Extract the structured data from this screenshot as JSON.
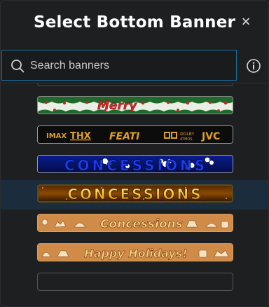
{
  "dialog": {
    "title": "Select Bottom Banner",
    "close_glyph": "×",
    "close_icon": "close-icon"
  },
  "search": {
    "placeholder": "Search banners",
    "value": "",
    "icon": "search-icon",
    "info_icon": "info-icon"
  },
  "colors": {
    "accent": "#1d6fa3",
    "selected_row": "#1b2c3c",
    "background": "#1e1f21"
  },
  "banners": [
    {
      "style": "christmas-garland",
      "text": "Merry"
    },
    {
      "style": "theater-logos",
      "logos": [
        "IMAX",
        "THX",
        "FEATI",
        "DOLBY",
        "ATMOS",
        "JVC"
      ]
    },
    {
      "style": "blue-popcorn",
      "text": "CONCESSIONS"
    },
    {
      "style": "gold-marquee",
      "text": "CONCESSIONS",
      "selected": true
    },
    {
      "style": "gingerbread",
      "text": "Concessions"
    },
    {
      "style": "gingerbread",
      "text": "Happy Holidays!"
    },
    {
      "style": "empty",
      "text": ""
    }
  ]
}
